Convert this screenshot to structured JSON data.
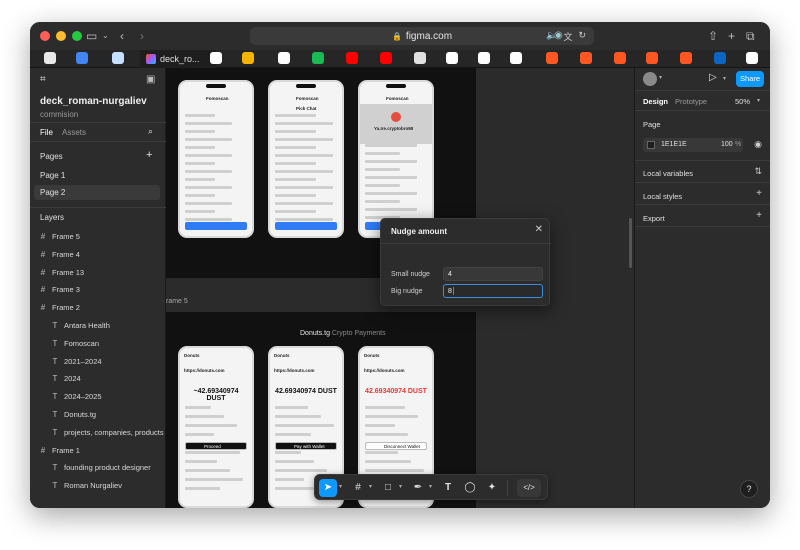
{
  "browser": {
    "url": "figma.com",
    "tab_active_label": "deck_ro...",
    "tab_colors": [
      "#e8e8e8",
      "#4285f4",
      "#c6e0ff",
      "#ffffff",
      "#f4b400",
      "#ffffff",
      "#1db954",
      "#ff0000",
      "#ff0000",
      "#e0e0e0",
      "#ffffff",
      "#ffffff",
      "#ffffff",
      "#ff5722",
      "#ff5722",
      "#ff5722",
      "#ff5722",
      "#ff5722",
      "#0a66c2",
      "#ffffff",
      "#4285f4"
    ]
  },
  "left_panel": {
    "project_name": "deck_roman-nurgaliev",
    "project_sub": "commision",
    "tab_file": "File",
    "tab_assets": "Assets",
    "pages_title": "Pages",
    "pages": [
      "Page 1",
      "Page 2"
    ],
    "layers_title": "Layers",
    "layers": [
      {
        "type": "frame",
        "name": "Frame 5",
        "indent": 0
      },
      {
        "type": "frame",
        "name": "Frame 4",
        "indent": 0
      },
      {
        "type": "frame",
        "name": "Frame 13",
        "indent": 0
      },
      {
        "type": "frame",
        "name": "Frame 3",
        "indent": 0
      },
      {
        "type": "frame",
        "name": "Frame 2",
        "indent": 0
      },
      {
        "type": "text",
        "name": "Antara Health",
        "indent": 1
      },
      {
        "type": "text",
        "name": "Fomoscan",
        "indent": 1
      },
      {
        "type": "text",
        "name": "2021–2024",
        "indent": 1
      },
      {
        "type": "text",
        "name": "2024",
        "indent": 1
      },
      {
        "type": "text",
        "name": "2024–2025",
        "indent": 1
      },
      {
        "type": "text",
        "name": "Donuts.tg",
        "indent": 1
      },
      {
        "type": "text",
        "name": "projects, companies, products",
        "indent": 1
      },
      {
        "type": "frame",
        "name": "Frame 1",
        "indent": 0
      },
      {
        "type": "text",
        "name": "founding product designer",
        "indent": 1
      },
      {
        "type": "text",
        "name": "Roman Nurgaliev",
        "indent": 1
      }
    ]
  },
  "canvas": {
    "frame_label": "rame 5",
    "frame_title": "Donuts.tg",
    "frame_title_suffix": " Crypto Payments",
    "phones_top": [
      {
        "title": "Fomoscan",
        "subtitle": ""
      },
      {
        "title": "Fomoscan",
        "subtitle": "Pick Chat"
      },
      {
        "title": "Fomoscan",
        "subtitle": "Ya.Ire.cryptobroMI"
      }
    ],
    "phones_bottom": [
      {
        "header": "Donuts",
        "url": "https://donuts.com",
        "amount": "~42.69340974 DUST",
        "btn": "Proceed"
      },
      {
        "header": "Donuts",
        "url": "https://donuts.com",
        "amount": "42.69340974 DUST",
        "btn": "Pay with Wallet"
      },
      {
        "header": "Donuts",
        "url": "https://donuts.com",
        "amount": "42.69340974 DUST",
        "btn": "Disconnect Wallet"
      }
    ]
  },
  "nudge_dialog": {
    "title": "Nudge amount",
    "small_label": "Small nudge",
    "small_value": "4",
    "big_label": "Big nudge",
    "big_value": "8"
  },
  "right_panel": {
    "share": "Share",
    "tab_design": "Design",
    "tab_prototype": "Prototype",
    "zoom": "50%",
    "page_title": "Page",
    "page_color_hex": "1E1E1E",
    "page_opacity": "100",
    "page_opacity_unit": "%",
    "local_variables": "Local variables",
    "local_styles": "Local styles",
    "export": "Export"
  },
  "help": "?",
  "colors": {
    "accent": "#0d99ff",
    "light_red": "#ff5f57",
    "light_yellow": "#febc2e",
    "light_green": "#28c840"
  }
}
